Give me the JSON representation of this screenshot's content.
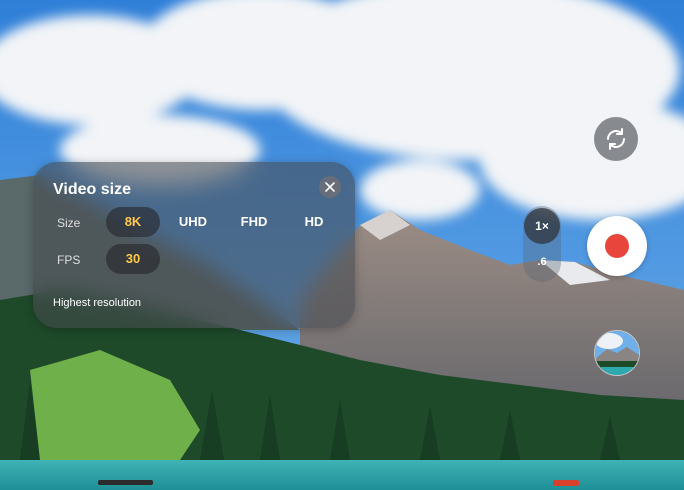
{
  "panel": {
    "title": "Video size",
    "size_label": "Size",
    "fps_label": "FPS",
    "size_options": [
      "8K",
      "UHD",
      "FHD",
      "HD"
    ],
    "size_selected": "8K",
    "fps_value": "30",
    "hint": "Highest resolution"
  },
  "controls": {
    "zoom_main": "1×",
    "zoom_alt": ".6"
  },
  "colors": {
    "selected_text": "#ffc84a",
    "record": "#e8453c"
  },
  "icons": {
    "close": "close-icon",
    "flip": "flip-camera-icon",
    "thumbnail": "gallery-thumbnail"
  }
}
